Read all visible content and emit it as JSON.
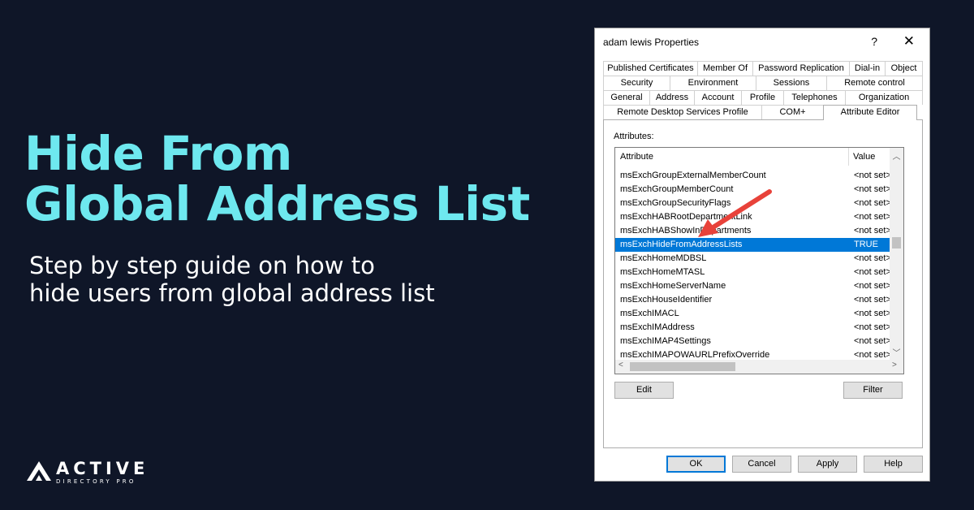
{
  "banner": {
    "headline_line1": "Hide From",
    "headline_line2": "Global Address List",
    "subhead_line1": "Step by step guide on how to",
    "subhead_line2": "hide users from global address list",
    "logo_word": "ACTIVE",
    "logo_sub": "DIRECTORY PRO"
  },
  "dialog": {
    "title": "adam lewis Properties",
    "help_glyph": "?",
    "close_glyph": "✕",
    "tab_rows": [
      [
        "Published Certificates",
        "Member Of",
        "Password Replication",
        "Dial-in",
        "Object"
      ],
      [
        "Security",
        "Environment",
        "Sessions",
        "Remote control"
      ],
      [
        "General",
        "Address",
        "Account",
        "Profile",
        "Telephones",
        "Organization"
      ],
      [
        "Remote Desktop Services Profile",
        "COM+",
        "Attribute Editor"
      ]
    ],
    "active_tab": "Attribute Editor",
    "attributes_label": "Attributes:",
    "columns": {
      "attribute": "Attribute",
      "value": "Value"
    },
    "rows": [
      {
        "attribute": "msExchGroupExternalMemberCount",
        "value": "<not set>"
      },
      {
        "attribute": "msExchGroupMemberCount",
        "value": "<not set>"
      },
      {
        "attribute": "msExchGroupSecurityFlags",
        "value": "<not set>"
      },
      {
        "attribute": "msExchHABRootDepartmentLink",
        "value": "<not set>"
      },
      {
        "attribute": "msExchHABShowInDepartments",
        "value": "<not set>"
      },
      {
        "attribute": "msExchHideFromAddressLists",
        "value": "TRUE",
        "selected": true
      },
      {
        "attribute": "msExchHomeMDBSL",
        "value": "<not set>"
      },
      {
        "attribute": "msExchHomeMTASL",
        "value": "<not set>"
      },
      {
        "attribute": "msExchHomeServerName",
        "value": "<not set>"
      },
      {
        "attribute": "msExchHouseIdentifier",
        "value": "<not set>"
      },
      {
        "attribute": "msExchIMACL",
        "value": "<not set>"
      },
      {
        "attribute": "msExchIMAddress",
        "value": "<not set>"
      },
      {
        "attribute": "msExchIMAP4Settings",
        "value": "<not set>"
      },
      {
        "attribute": "msExchIMAPOWAURLPrefixOverride",
        "value": "<not set>"
      }
    ],
    "edit_label": "Edit",
    "filter_label": "Filter",
    "ok_label": "OK",
    "cancel_label": "Cancel",
    "apply_label": "Apply",
    "help_label": "Help"
  },
  "colors": {
    "background": "#0f1628",
    "headline": "#6ee8ef",
    "selection": "#0078d7",
    "annotation_arrow": "#e8423a"
  },
  "icons": {
    "logo": "active-directory-pro-logo",
    "arrow": "red-annotation-arrow"
  }
}
